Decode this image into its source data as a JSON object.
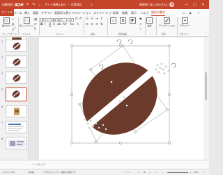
{
  "window": {
    "autosave_label": "自動保存",
    "toggle_state": "オフ",
    "filename": "サイト画像.pptx",
    "save_status": "・ 兄貴保存",
    "user_name": "篠原昌 (ほしみのぎん)",
    "user_initials": "篠",
    "brand_color": "#c4452a"
  },
  "menu": {
    "tabs": [
      "ファイル",
      "ホーム",
      "挿入",
      "描画",
      "デザイン",
      "画面切り替え",
      "アニメーション",
      "スライド ショー",
      "記録",
      "校閲",
      "表示",
      "ヘルプ",
      "図形の書式"
    ],
    "active_index": 12
  },
  "ribbon": {
    "paste_label": "貼り付け",
    "new_slide_label": "新しいスライド",
    "font_name": "游ゴシック本文 (本文)",
    "font_size": "18",
    "draw_label": "描画",
    "editing_label": "編集",
    "voice_label": "ディクテーション",
    "designer_label": "デザイナー",
    "groups": [
      "クリップボード",
      "スライド",
      "フォント",
      "段落",
      "図形描画",
      "音声",
      "デザイナー"
    ]
  },
  "slides": {
    "numbers": [
      "",
      "2",
      "3",
      "4",
      "5",
      "6",
      "7",
      "8"
    ],
    "selected_index": 4
  },
  "canvas": {
    "bean_color": "#6b3a2a",
    "selection_color": "#888888"
  },
  "notes": {
    "placeholder": "ノートを入力"
  },
  "status": {
    "slide_info": "スライド 5/8",
    "language": "日本語",
    "accessibility": "アクセシビリティ: 検討が必要です",
    "notes_label": "ノート",
    "zoom": "60%"
  }
}
